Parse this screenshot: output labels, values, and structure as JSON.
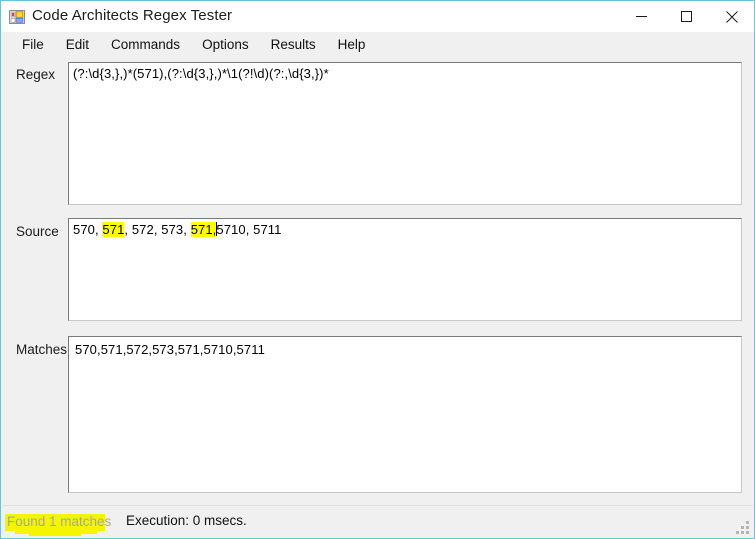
{
  "window": {
    "title": "Code Architects Regex Tester",
    "icon": "app-form-icon",
    "controls": {
      "minimize": "minimize-icon",
      "maximize": "maximize-icon",
      "close": "close-icon"
    }
  },
  "menu": {
    "items": [
      {
        "label": "File"
      },
      {
        "label": "Edit"
      },
      {
        "label": "Commands"
      },
      {
        "label": "Options"
      },
      {
        "label": "Results"
      },
      {
        "label": "Help"
      }
    ]
  },
  "fields": {
    "regex": {
      "label": "Regex",
      "value": "(?:\\d{3,},)*(571),(?:\\d{3,},)*\\1(?!\\d)(?:,\\d{3,})*"
    },
    "source": {
      "label": "Source",
      "value": "570, 571, 572, 573, 571, 5710, 5711",
      "segments": [
        {
          "text": "570, ",
          "highlight": false
        },
        {
          "text": "571",
          "highlight": true
        },
        {
          "text": ", 572, 573, ",
          "highlight": false
        },
        {
          "text": "571,",
          "highlight": true
        },
        {
          "text": "",
          "caret": true
        },
        {
          "text": "5710, 5711",
          "highlight": false
        }
      ]
    },
    "matches": {
      "label": "Matches",
      "value": "570,571,572,573,571,5710,5711"
    }
  },
  "status": {
    "found": "Found 1 matches",
    "execution": "Execution: 0 msecs.",
    "grip": "resize-grip-icon"
  },
  "colors": {
    "window_border": "#6bc3d8",
    "highlight": "#ffff00",
    "marker": "#f5f500",
    "panel": "#f0f0f0",
    "status_found_text": "#a6a6a6"
  }
}
